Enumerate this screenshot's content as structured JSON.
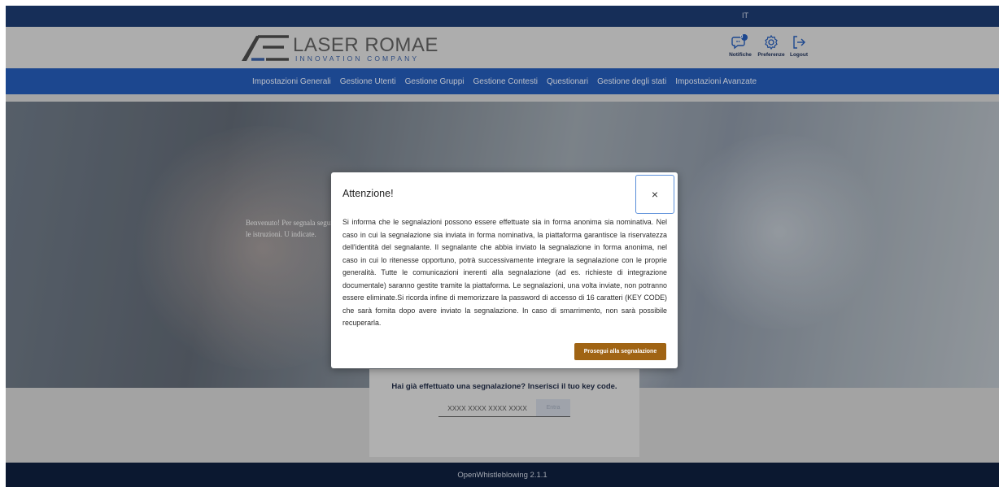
{
  "language": "IT",
  "brand": {
    "name": "LASER ROMAE",
    "tagline": "INNOVATION COMPANY",
    "accent_color": "#3a5ea0"
  },
  "header_actions": [
    {
      "label": "Notifiche",
      "icon": "notification-icon",
      "badge": "0"
    },
    {
      "label": "Preferenze",
      "icon": "gear-icon"
    },
    {
      "label": "Logout",
      "icon": "logout-icon"
    }
  ],
  "nav": {
    "items": [
      "Impostazioni Generali",
      "Gestione Utenti",
      "Gestione Gruppi",
      "Gestione Contesti",
      "Questionari",
      "Gestione degli stati",
      "Impostazioni Avanzate"
    ]
  },
  "hero": {
    "text": "Benvenuto! Per segnala segui le istruzioni. U indicate."
  },
  "keycode": {
    "title": "Hai già effettuato una segnalazione? Inserisci il tuo key code.",
    "placeholder": "XXXX XXXX XXXX XXXX",
    "button_label": "Entra"
  },
  "footer": {
    "text": "OpenWhistleblowing 2.1.1"
  },
  "modal": {
    "title": "Attenzione!",
    "close_label": "×",
    "body": "Si informa che le segnalazioni possono essere effettuate sia in forma anonima sia nominativa. Nel caso in cui la segnalazione sia inviata in forma nominativa, la piattaforma garantisce la riservatezza dell'identità del segnalante. Il segnalante che abbia inviato la segnalazione in forma anonima, nel caso in cui lo ritenesse opportuno, potrà successivamente integrare la segnalazione con le proprie generalità. Tutte le comunicazioni inerenti alla segnalazione (ad es. richieste di integrazione documentale) saranno gestite tramite la piattaforma. Le segnalazioni, una volta inviate, non potranno essere eliminate.Si ricorda infine di memorizzare la password di accesso di 16 caratteri (KEY CODE) che sarà fornita dopo avere inviato la segnalazione. In caso di smarrimento, non sarà possibile recuperarla.",
    "proceed_label": "Prosegui alla segnalazione",
    "proceed_color": "#a06414"
  },
  "colors": {
    "topbar": "#1c3a6e",
    "nav": "#2459b3",
    "footer": "#0e1e3c"
  }
}
